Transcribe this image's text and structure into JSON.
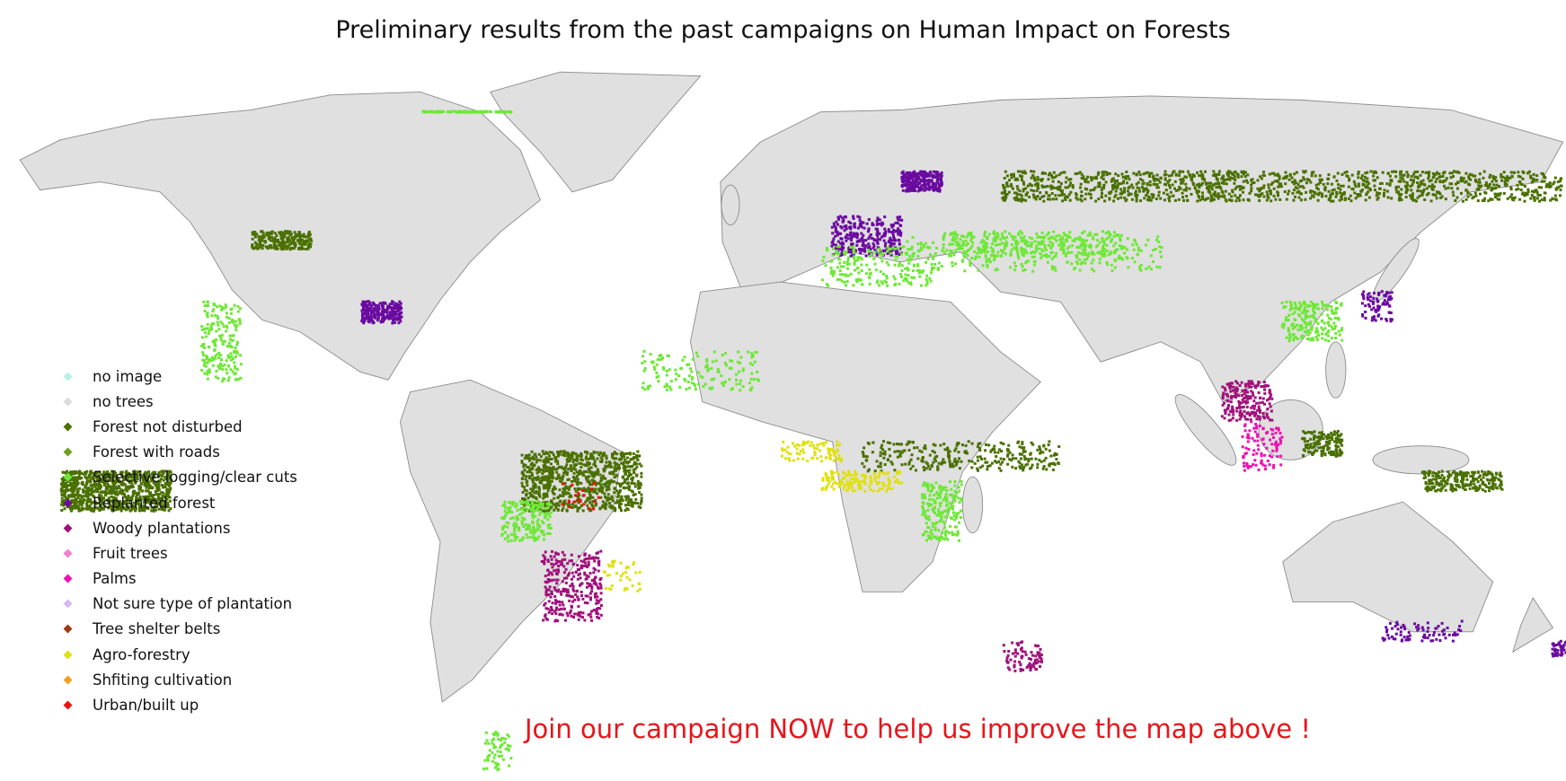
{
  "title": "Preliminary results from the past campaigns on Human Impact on Forests",
  "call_to_action": "Join our campaign NOW to help us improve the map above !",
  "map": {
    "land_color": "#e0e0e0",
    "border_color": "#8a8a8a"
  },
  "legend": [
    {
      "label": "no image",
      "color": "#b8f0e8"
    },
    {
      "label": "no trees",
      "color": "#dcdcdc"
    },
    {
      "label": "Forest not disturbed",
      "color": "#4a7000"
    },
    {
      "label": "Forest with roads",
      "color": "#6fa020"
    },
    {
      "label": "Selective logging/clear cuts",
      "color": "#6ee836"
    },
    {
      "label": "Replanted forest",
      "color": "#6a0aa0"
    },
    {
      "label": "Woody plantations",
      "color": "#a0107a"
    },
    {
      "label": "Fruit trees",
      "color": "#f080d0"
    },
    {
      "label": "Palms",
      "color": "#f010b0"
    },
    {
      "label": "Not sure type of plantation",
      "color": "#d8b8f0"
    },
    {
      "label": "Tree shelter belts",
      "color": "#a03a10"
    },
    {
      "label": "Agro-forestry",
      "color": "#e0e010"
    },
    {
      "label": "Shfiting cultivation",
      "color": "#f0a020"
    },
    {
      "label": "Urban/built up",
      "color": "#f01010"
    }
  ]
}
